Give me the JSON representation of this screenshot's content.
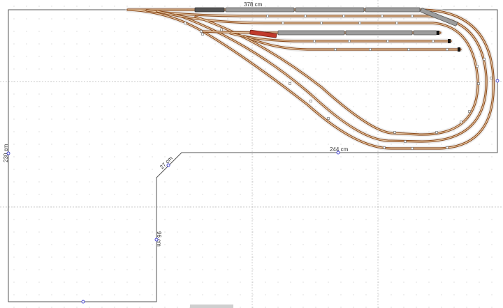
{
  "layout": {
    "dimensions": {
      "top_length": "378 cm",
      "left_length": "230 cm",
      "inner_top_length": "244 cm",
      "diagonal_length": "27 cm",
      "inner_vertical_length": "96 cm"
    }
  },
  "colors": {
    "rail": "#8a4a1c",
    "rail_highlight": "#e8c9a5",
    "board_outline": "#555555",
    "handle": "#3a3acf",
    "train_body": "#9c9c9c",
    "locomotive_red": "#c0392b"
  },
  "icons": [
    "selection-handle-icon",
    "buffer-stop-icon"
  ]
}
